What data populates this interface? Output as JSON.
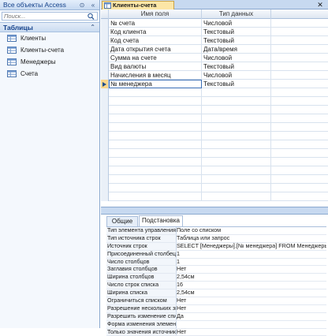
{
  "nav": {
    "title": "Все объекты Access",
    "search_placeholder": "Поиск...",
    "group_title": "Таблицы",
    "items": [
      {
        "label": "Клиенты"
      },
      {
        "label": "Клиенты-счета"
      },
      {
        "label": "Менеджеры"
      },
      {
        "label": "Счета"
      }
    ]
  },
  "document": {
    "tab_label": "Клиенты-счета"
  },
  "grid": {
    "columns": {
      "field_name": "Имя поля",
      "data_type": "Тип данных"
    },
    "rows": [
      {
        "name": "№ счета",
        "type": "Числовой"
      },
      {
        "name": "Код клиента",
        "type": "Текстовый"
      },
      {
        "name": "Код счета",
        "type": "Текстовый"
      },
      {
        "name": "Дата открытия счета",
        "type": "Дата/время"
      },
      {
        "name": "Сумма на счете",
        "type": "Числовой"
      },
      {
        "name": "Вид валюты",
        "type": "Текстовый"
      },
      {
        "name": "Начисления в месяц",
        "type": "Числовой"
      },
      {
        "name": "№ менеджера",
        "type": "Текстовый"
      }
    ],
    "active_row": 7
  },
  "properties": {
    "tabs": [
      "Общие",
      "Подстановка"
    ],
    "active_tab": "Подстановка",
    "rows": [
      {
        "name": "Тип элемента управления",
        "value": "Поле со списком"
      },
      {
        "name": "Тип источника строк",
        "value": "Таблица или запрос"
      },
      {
        "name": "Источник строк",
        "value": "SELECT [Менеджеры].[№ менеджера] FROM Менеджеры;"
      },
      {
        "name": "Присоединенный столбец",
        "value": "1"
      },
      {
        "name": "Число столбцов",
        "value": "1"
      },
      {
        "name": "Заглавия столбцов",
        "value": "Нет"
      },
      {
        "name": "Ширина столбцов",
        "value": "2,54см"
      },
      {
        "name": "Число строк списка",
        "value": "16"
      },
      {
        "name": "Ширина списка",
        "value": "2,54см"
      },
      {
        "name": "Ограничиться списком",
        "value": "Нет"
      },
      {
        "name": "Разрешение нескольких значений",
        "value": "Нет"
      },
      {
        "name": "Разрешить изменение списка",
        "value": "Да"
      },
      {
        "name": "Форма изменения элементов списка",
        "value": ""
      },
      {
        "name": "Только значения источника строк",
        "value": "Нет"
      }
    ]
  },
  "colors": {
    "ribbon_blue": "#c7d9f0",
    "active_tab": "#fce6a6",
    "header_text": "#15428b"
  }
}
